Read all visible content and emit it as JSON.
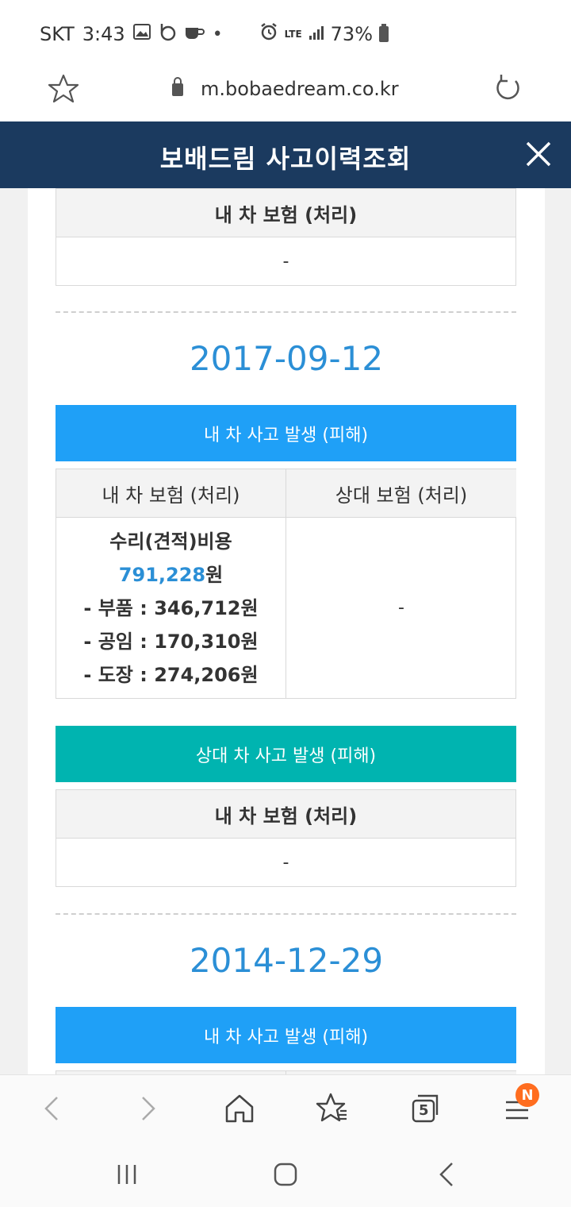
{
  "status_bar": {
    "carrier": "SKT",
    "time": "3:43",
    "network": "LTE",
    "battery": "73%"
  },
  "browser": {
    "url": "m.bobaedream.co.kr"
  },
  "header": {
    "title": "보배드림 사고이력조회"
  },
  "records": {
    "top_table": {
      "header": "내 차 보험 (처리)",
      "value": "-"
    },
    "record_1": {
      "date": "2017-09-12",
      "my_accident_banner": "내 차 사고 발생 (피해)",
      "my_ins_header": "내 차 보험 (처리)",
      "other_ins_header": "상대 보험 (처리)",
      "repair_label": "수리(견적)비용",
      "repair_amount": "791,228",
      "won": "원",
      "parts": "- 부품 : 346,712원",
      "labor": "- 공임 : 170,310원",
      "paint": "- 도장 : 274,206원",
      "other_value": "-",
      "other_accident_banner": "상대 차 사고 발생 (피해)",
      "other_table_header": "내 차 보험 (처리)",
      "other_table_value": "-"
    },
    "record_2": {
      "date": "2014-12-29",
      "my_accident_banner": "내 차 사고 발생 (피해)"
    }
  },
  "bottom_nav": {
    "tabs_count": "5",
    "menu_badge": "N"
  }
}
